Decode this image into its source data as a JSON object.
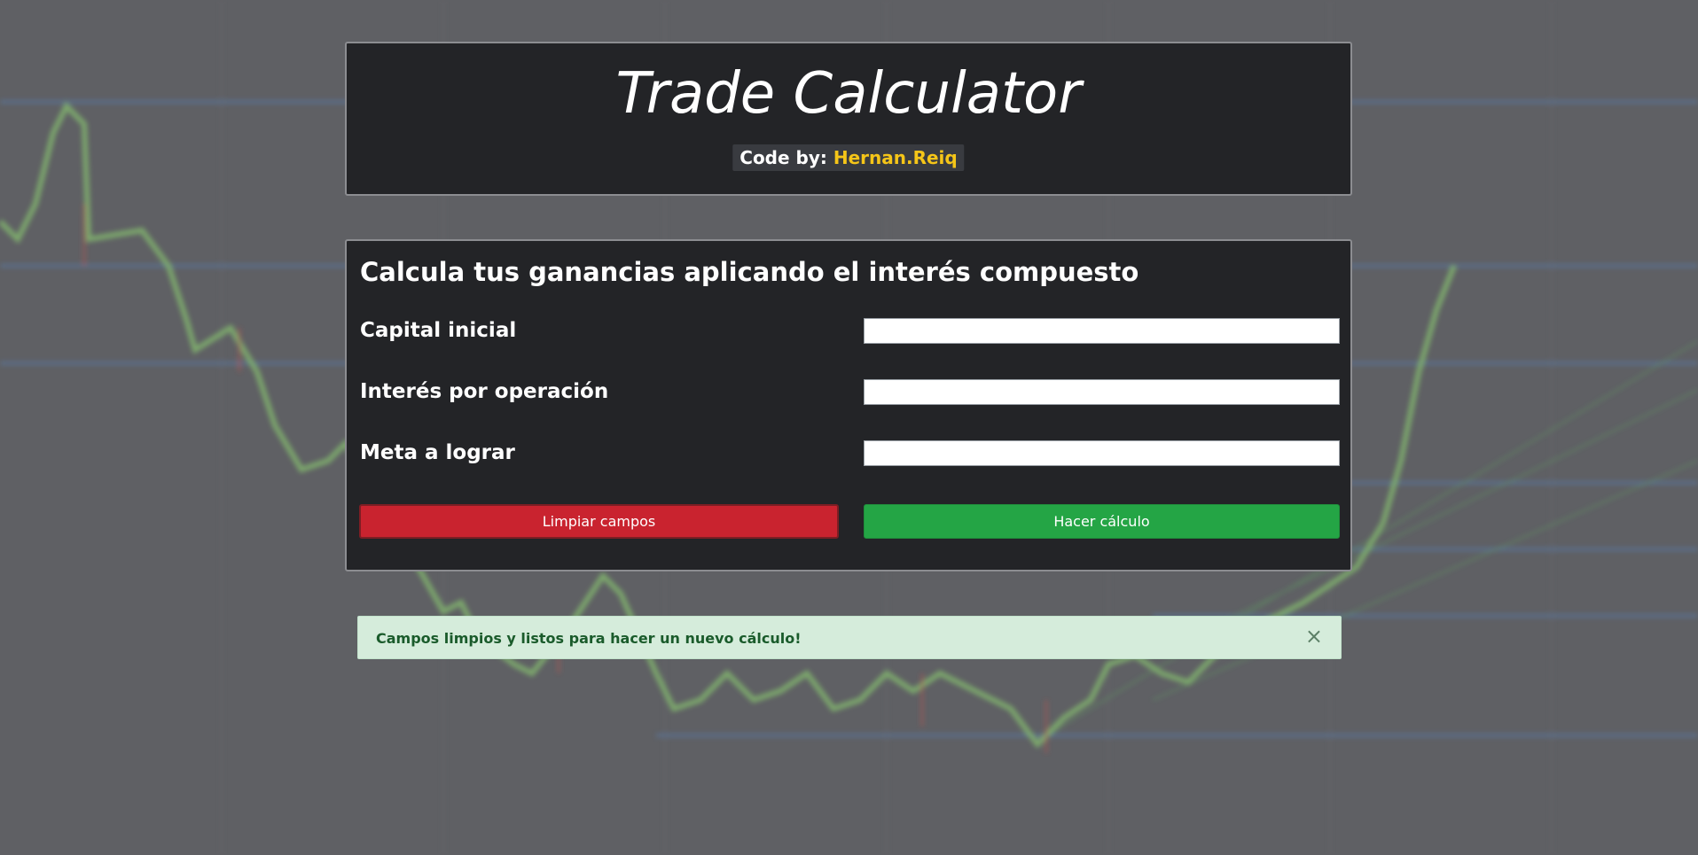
{
  "header": {
    "title": "Trade Calculator",
    "credit_prefix": "Code by:",
    "credit_author": "Hernan.Reiq"
  },
  "form": {
    "title": "Calcula tus ganancias aplicando el interés compuesto",
    "fields": [
      {
        "label": "Capital inicial",
        "value": ""
      },
      {
        "label": "Interés por operación",
        "value": ""
      },
      {
        "label": "Meta a lograr",
        "value": ""
      }
    ],
    "clear_label": "Limpiar campos",
    "calc_label": "Hacer cálculo"
  },
  "alert": {
    "message": "Campos limpios y listos para hacer un nuevo cálculo!",
    "close_symbol": "×"
  },
  "colors": {
    "card_bg": "#232427",
    "accent_author": "#f5c518",
    "danger": "#c9232f",
    "success": "#24a545",
    "alert_bg": "#d5ecdb",
    "alert_text": "#1a5b2b"
  }
}
